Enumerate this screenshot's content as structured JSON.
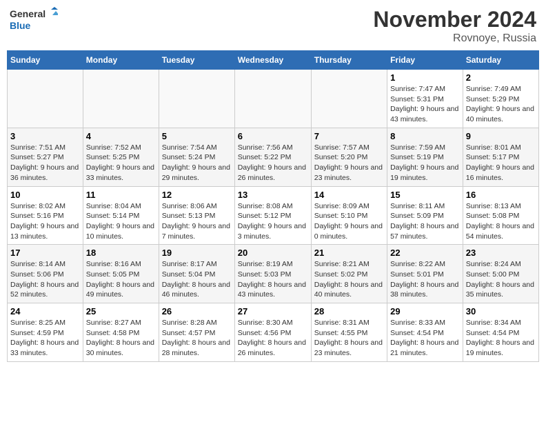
{
  "logo": {
    "line1": "General",
    "line2": "Blue"
  },
  "title": "November 2024",
  "location": "Rovnoye, Russia",
  "days_header": [
    "Sunday",
    "Monday",
    "Tuesday",
    "Wednesday",
    "Thursday",
    "Friday",
    "Saturday"
  ],
  "weeks": [
    [
      {
        "day": "",
        "info": ""
      },
      {
        "day": "",
        "info": ""
      },
      {
        "day": "",
        "info": ""
      },
      {
        "day": "",
        "info": ""
      },
      {
        "day": "",
        "info": ""
      },
      {
        "day": "1",
        "info": "Sunrise: 7:47 AM\nSunset: 5:31 PM\nDaylight: 9 hours and 43 minutes."
      },
      {
        "day": "2",
        "info": "Sunrise: 7:49 AM\nSunset: 5:29 PM\nDaylight: 9 hours and 40 minutes."
      }
    ],
    [
      {
        "day": "3",
        "info": "Sunrise: 7:51 AM\nSunset: 5:27 PM\nDaylight: 9 hours and 36 minutes."
      },
      {
        "day": "4",
        "info": "Sunrise: 7:52 AM\nSunset: 5:25 PM\nDaylight: 9 hours and 33 minutes."
      },
      {
        "day": "5",
        "info": "Sunrise: 7:54 AM\nSunset: 5:24 PM\nDaylight: 9 hours and 29 minutes."
      },
      {
        "day": "6",
        "info": "Sunrise: 7:56 AM\nSunset: 5:22 PM\nDaylight: 9 hours and 26 minutes."
      },
      {
        "day": "7",
        "info": "Sunrise: 7:57 AM\nSunset: 5:20 PM\nDaylight: 9 hours and 23 minutes."
      },
      {
        "day": "8",
        "info": "Sunrise: 7:59 AM\nSunset: 5:19 PM\nDaylight: 9 hours and 19 minutes."
      },
      {
        "day": "9",
        "info": "Sunrise: 8:01 AM\nSunset: 5:17 PM\nDaylight: 9 hours and 16 minutes."
      }
    ],
    [
      {
        "day": "10",
        "info": "Sunrise: 8:02 AM\nSunset: 5:16 PM\nDaylight: 9 hours and 13 minutes."
      },
      {
        "day": "11",
        "info": "Sunrise: 8:04 AM\nSunset: 5:14 PM\nDaylight: 9 hours and 10 minutes."
      },
      {
        "day": "12",
        "info": "Sunrise: 8:06 AM\nSunset: 5:13 PM\nDaylight: 9 hours and 7 minutes."
      },
      {
        "day": "13",
        "info": "Sunrise: 8:08 AM\nSunset: 5:12 PM\nDaylight: 9 hours and 3 minutes."
      },
      {
        "day": "14",
        "info": "Sunrise: 8:09 AM\nSunset: 5:10 PM\nDaylight: 9 hours and 0 minutes."
      },
      {
        "day": "15",
        "info": "Sunrise: 8:11 AM\nSunset: 5:09 PM\nDaylight: 8 hours and 57 minutes."
      },
      {
        "day": "16",
        "info": "Sunrise: 8:13 AM\nSunset: 5:08 PM\nDaylight: 8 hours and 54 minutes."
      }
    ],
    [
      {
        "day": "17",
        "info": "Sunrise: 8:14 AM\nSunset: 5:06 PM\nDaylight: 8 hours and 52 minutes."
      },
      {
        "day": "18",
        "info": "Sunrise: 8:16 AM\nSunset: 5:05 PM\nDaylight: 8 hours and 49 minutes."
      },
      {
        "day": "19",
        "info": "Sunrise: 8:17 AM\nSunset: 5:04 PM\nDaylight: 8 hours and 46 minutes."
      },
      {
        "day": "20",
        "info": "Sunrise: 8:19 AM\nSunset: 5:03 PM\nDaylight: 8 hours and 43 minutes."
      },
      {
        "day": "21",
        "info": "Sunrise: 8:21 AM\nSunset: 5:02 PM\nDaylight: 8 hours and 40 minutes."
      },
      {
        "day": "22",
        "info": "Sunrise: 8:22 AM\nSunset: 5:01 PM\nDaylight: 8 hours and 38 minutes."
      },
      {
        "day": "23",
        "info": "Sunrise: 8:24 AM\nSunset: 5:00 PM\nDaylight: 8 hours and 35 minutes."
      }
    ],
    [
      {
        "day": "24",
        "info": "Sunrise: 8:25 AM\nSunset: 4:59 PM\nDaylight: 8 hours and 33 minutes."
      },
      {
        "day": "25",
        "info": "Sunrise: 8:27 AM\nSunset: 4:58 PM\nDaylight: 8 hours and 30 minutes."
      },
      {
        "day": "26",
        "info": "Sunrise: 8:28 AM\nSunset: 4:57 PM\nDaylight: 8 hours and 28 minutes."
      },
      {
        "day": "27",
        "info": "Sunrise: 8:30 AM\nSunset: 4:56 PM\nDaylight: 8 hours and 26 minutes."
      },
      {
        "day": "28",
        "info": "Sunrise: 8:31 AM\nSunset: 4:55 PM\nDaylight: 8 hours and 23 minutes."
      },
      {
        "day": "29",
        "info": "Sunrise: 8:33 AM\nSunset: 4:54 PM\nDaylight: 8 hours and 21 minutes."
      },
      {
        "day": "30",
        "info": "Sunrise: 8:34 AM\nSunset: 4:54 PM\nDaylight: 8 hours and 19 minutes."
      }
    ]
  ]
}
